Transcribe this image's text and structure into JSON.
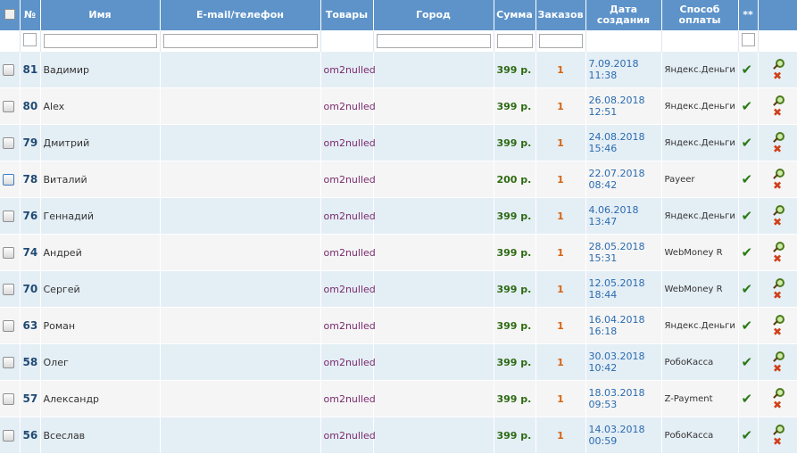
{
  "headers": {
    "num": "№",
    "name": "Имя",
    "contact": "E-mail/телефон",
    "goods": "Товары",
    "city": "Город",
    "sum": "Сумма",
    "orders": "Заказов",
    "date": "Дата создания",
    "payment": "Способ оплаты",
    "extra": "**"
  },
  "rows": [
    {
      "num": "81",
      "name": "Вадимир",
      "goods": "om2nulled",
      "sum": "399 р.",
      "orders": "1",
      "date": "7.09.2018",
      "time": "11:38",
      "payment": "Яндекс.Деньги"
    },
    {
      "num": "80",
      "name": "Alex",
      "goods": "om2nulled",
      "sum": "399 р.",
      "orders": "1",
      "date": "26.08.2018",
      "time": "12:51",
      "payment": "Яндекс.Деньги"
    },
    {
      "num": "79",
      "name": "Дмитрий",
      "goods": "om2nulled",
      "sum": "399 р.",
      "orders": "1",
      "date": "24.08.2018",
      "time": "15:46",
      "payment": "Яндекс.Деньги"
    },
    {
      "num": "78",
      "name": "Виталий",
      "goods": "om2nulled",
      "sum": "200 р.",
      "orders": "1",
      "date": "22.07.2018",
      "time": "08:42",
      "payment": "Payeer"
    },
    {
      "num": "76",
      "name": "Геннадий",
      "goods": "om2nulled",
      "sum": "399 р.",
      "orders": "1",
      "date": "4.06.2018",
      "time": "13:47",
      "payment": "Яндекс.Деньги"
    },
    {
      "num": "74",
      "name": "Андрей",
      "goods": "om2nulled",
      "sum": "399 р.",
      "orders": "1",
      "date": "28.05.2018",
      "time": "15:31",
      "payment": "WebMoney R"
    },
    {
      "num": "70",
      "name": "Сергей",
      "goods": "om2nulled",
      "sum": "399 р.",
      "orders": "1",
      "date": "12.05.2018",
      "time": "18:44",
      "payment": "WebMoney R"
    },
    {
      "num": "63",
      "name": "Роман",
      "goods": "om2nulled",
      "sum": "399 р.",
      "orders": "1",
      "date": "16.04.2018",
      "time": "16:18",
      "payment": "Яндекс.Деньги"
    },
    {
      "num": "58",
      "name": "Олег",
      "goods": "om2nulled",
      "sum": "399 р.",
      "orders": "1",
      "date": "30.03.2018",
      "time": "10:42",
      "payment": "РобоКасса"
    },
    {
      "num": "57",
      "name": "Александр",
      "goods": "om2nulled",
      "sum": "399 р.",
      "orders": "1",
      "date": "18.03.2018",
      "time": "09:53",
      "payment": "Z-Payment"
    },
    {
      "num": "56",
      "name": "Всеслав",
      "goods": "om2nulled",
      "sum": "399 р.",
      "orders": "1",
      "date": "14.03.2018",
      "time": "00:59",
      "payment": "РобоКасса"
    }
  ],
  "colors": {
    "header_bg": "#5d93c9",
    "row_odd": "#e4eef5",
    "row_even": "#f5f5f5",
    "sum": "#2d6a12",
    "orders": "#d76511",
    "date": "#2a6bb0",
    "goods": "#7a2a6e"
  },
  "icons": {
    "paid": "checkmark-icon",
    "view": "magnifier-icon",
    "delete": "delete-icon"
  }
}
